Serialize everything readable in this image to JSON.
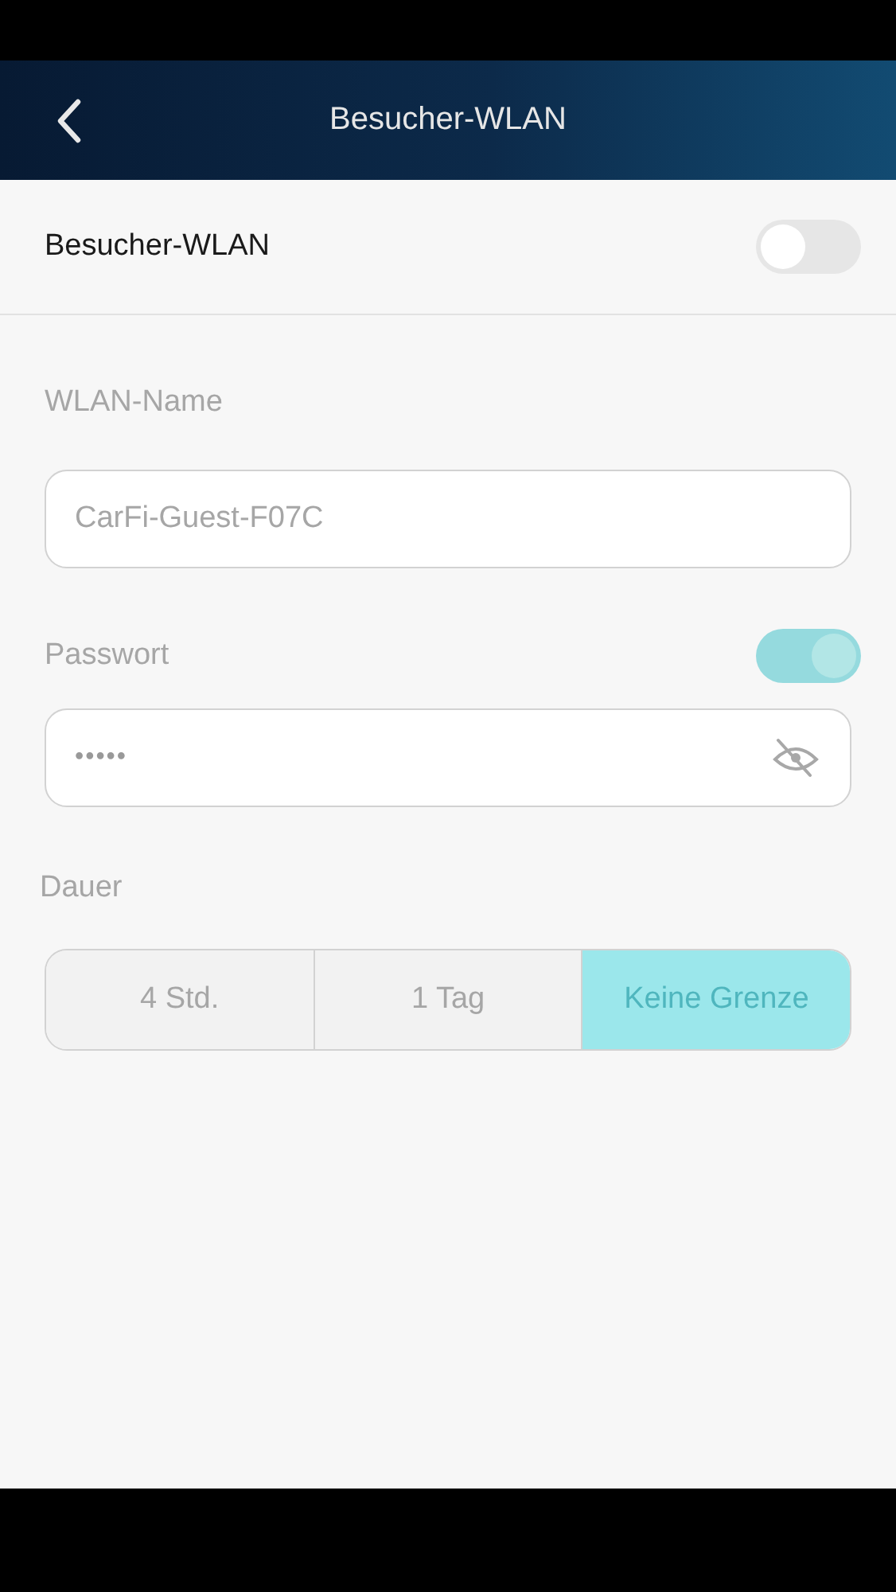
{
  "header": {
    "title": "Besucher-WLAN"
  },
  "guest_wlan": {
    "label": "Besucher-WLAN",
    "on": false
  },
  "form": {
    "disabled": true,
    "wlan_name": {
      "label": "WLAN-Name",
      "value": "CarFi-Guest-F07C"
    },
    "password": {
      "label": "Passwort",
      "on": true,
      "value": "•••••"
    },
    "duration": {
      "label": "Dauer",
      "options": [
        {
          "label": "4 Std.",
          "selected": false
        },
        {
          "label": "1 Tag",
          "selected": false
        },
        {
          "label": "Keine Grenze",
          "selected": true
        }
      ]
    }
  }
}
